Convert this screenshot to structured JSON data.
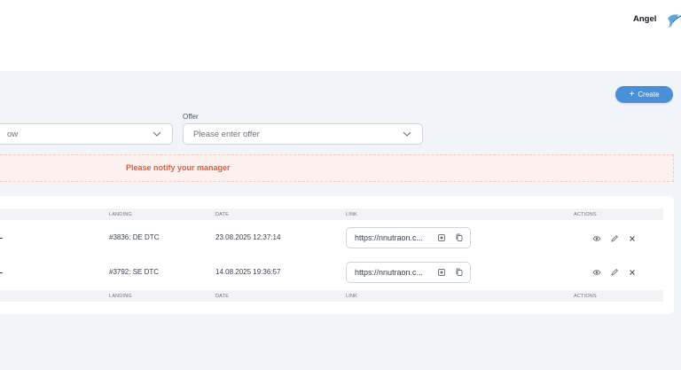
{
  "header": {
    "user_name": "Angel"
  },
  "toolbar": {
    "create_label": "Create"
  },
  "filters": {
    "first_value": "ow",
    "offer_label": "Offer",
    "offer_placeholder": "Please enter offer"
  },
  "alert": {
    "text": "Please notify your manager"
  },
  "table": {
    "columns": {
      "landing": "LANDING",
      "date": "DATE",
      "link": "LINK",
      "actions": "ACTIONS"
    },
    "rows": [
      {
        "landing": "#3836: DE DTC",
        "date": "23.08.2025 12:37:14",
        "link": "https://nnutraon.c..."
      },
      {
        "landing": "#3792: SE DTC",
        "date": "14.08.2025 19:36:57",
        "link": "https://nnutraon.c..."
      }
    ]
  },
  "colors": {
    "accent": "#4a90d9",
    "alert_text": "#e55a3a",
    "alert_bg": "#fdf1ef",
    "page_bg": "#f1f5f9"
  },
  "icons": [
    "avatar-bird-icon",
    "plus-icon",
    "chevron-down-icon",
    "qr-icon",
    "copy-icon",
    "eye-icon",
    "edit-icon",
    "close-icon"
  ]
}
